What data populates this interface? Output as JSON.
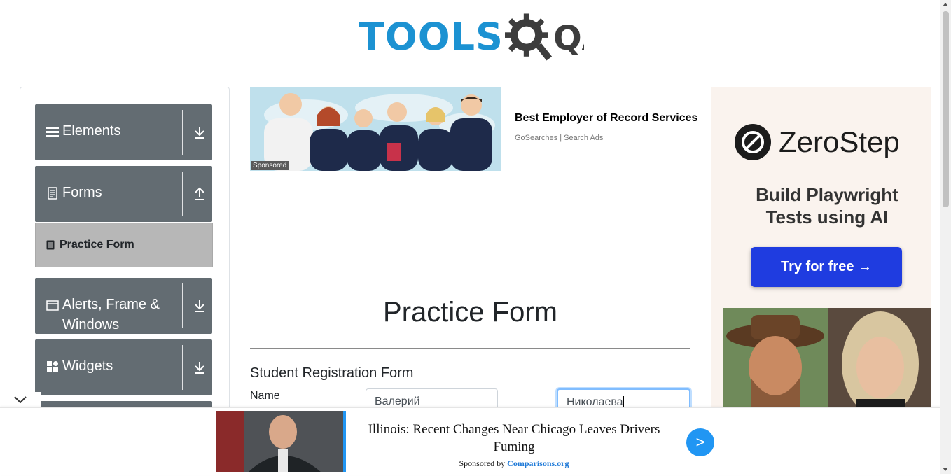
{
  "header": {
    "logo_text": "TOOLS",
    "logo_suffix": "QA"
  },
  "sidebar": {
    "groups": [
      {
        "title": "Elements",
        "icon": "hamburger-icon",
        "arrow": "download-arrow-icon"
      },
      {
        "title": "Forms",
        "icon": "document-icon",
        "arrow": "upload-arrow-icon",
        "items": [
          {
            "label": "Practice Form",
            "icon": "form-icon"
          }
        ]
      },
      {
        "title": "Alerts, Frame & Windows",
        "icon": "window-icon",
        "arrow": "download-arrow-icon"
      },
      {
        "title": "Widgets",
        "icon": "widgets-icon",
        "arrow": "download-arrow-icon"
      }
    ]
  },
  "ad_banner": {
    "sponsored_tag": "Sponsored",
    "title": "Best Employer of Record Services",
    "source": "GoSearches | Search Ads"
  },
  "main": {
    "page_title": "Practice Form",
    "form_title": "Student Registration Form",
    "name_label": "Name",
    "first_name_value": "Валерий",
    "last_name_value": "Николаева"
  },
  "side_ad": {
    "brand": "ZeroStep",
    "tagline_line1": "Build Playwright",
    "tagline_line2": "Tests using AI",
    "cta": "Try for free →"
  },
  "bottom_ad": {
    "headline": "Illinois: Recent Changes Near Chicago Leaves Drivers Fuming",
    "sponsor_prefix": "Sponsored by",
    "sponsor_name": "Comparisons.org",
    "go_label": ">"
  },
  "colors": {
    "logo_blue": "#1c92d2",
    "sidebar_group": "#636c72",
    "cta_blue": "#1f3ce0",
    "accent": "#2196f3"
  }
}
